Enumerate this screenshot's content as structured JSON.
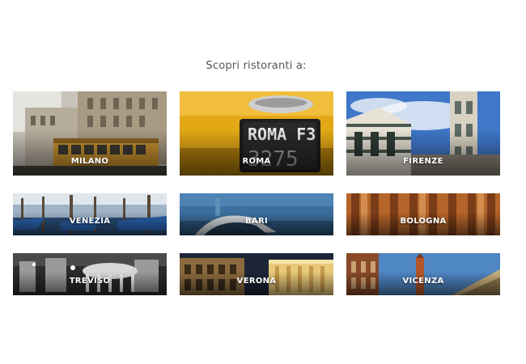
{
  "heading": "Scopri ristoranti a:",
  "cities": [
    {
      "name": "MILANO"
    },
    {
      "name": "ROMA",
      "plate_top": "ROMA F3",
      "plate_bottom": "3275"
    },
    {
      "name": "FIRENZE"
    },
    {
      "name": "VENEZIA"
    },
    {
      "name": "BARI"
    },
    {
      "name": "BOLOGNA"
    },
    {
      "name": "TREVISO"
    },
    {
      "name": "VERONA"
    },
    {
      "name": "VICENZA"
    }
  ]
}
